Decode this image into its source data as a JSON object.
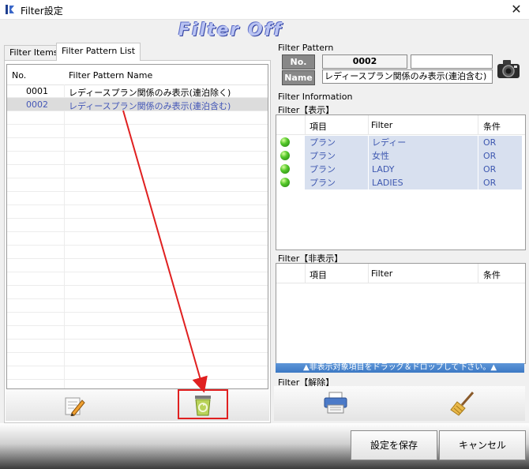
{
  "window": {
    "title": "Filter設定",
    "close_glyph": "✕",
    "banner": "Filter Off"
  },
  "tabs": [
    {
      "label": "Filter Items",
      "active": false
    },
    {
      "label": "Filter Pattern List",
      "active": true
    }
  ],
  "pattern_list": {
    "columns": [
      "No.",
      "Filter Pattern Name"
    ],
    "rows": [
      {
        "no": "0001",
        "name": "レディースプラン関係のみ表示(連泊除く)",
        "selected": false
      },
      {
        "no": "0002",
        "name": "レディースプラン関係のみ表示(連泊含む)",
        "selected": true
      }
    ]
  },
  "filter_pattern": {
    "section_label": "Filter Pattern",
    "no_label": "No.",
    "name_label": "Name",
    "no_value": "0002",
    "name_value": "レディースプラン関係のみ表示(連泊含む)"
  },
  "filter_info": {
    "section_label": "Filter Information",
    "display": {
      "label": "Filter【表示】",
      "columns": [
        "項目",
        "Filter",
        "条件"
      ],
      "rows": [
        {
          "item": "プラン",
          "filter": "レディー",
          "cond": "OR"
        },
        {
          "item": "プラン",
          "filter": "女性",
          "cond": "OR"
        },
        {
          "item": "プラン",
          "filter": "LADY",
          "cond": "OR"
        },
        {
          "item": "プラン",
          "filter": "LADIES",
          "cond": "OR"
        }
      ]
    },
    "hidden": {
      "label": "Filter【非表示】",
      "columns": [
        "項目",
        "Filter",
        "条件"
      ],
      "hint": "▲非表示対象項目をドラッグ＆ドロップして下さい。▲"
    },
    "release": {
      "label": "Filter【解除】"
    }
  },
  "footer": {
    "save_label": "設定を保存",
    "cancel_label": "キャンセル"
  },
  "colors": {
    "highlight_box": "#e02020",
    "arrow": "#e02020",
    "selected_row_text": "#4457b7",
    "filter_row_bg": "#d8e0ef"
  },
  "icons": [
    "app-icon",
    "close-icon",
    "edit-icon",
    "trash-icon",
    "camera-icon",
    "green-dot-icon",
    "printer-icon",
    "broom-icon"
  ]
}
